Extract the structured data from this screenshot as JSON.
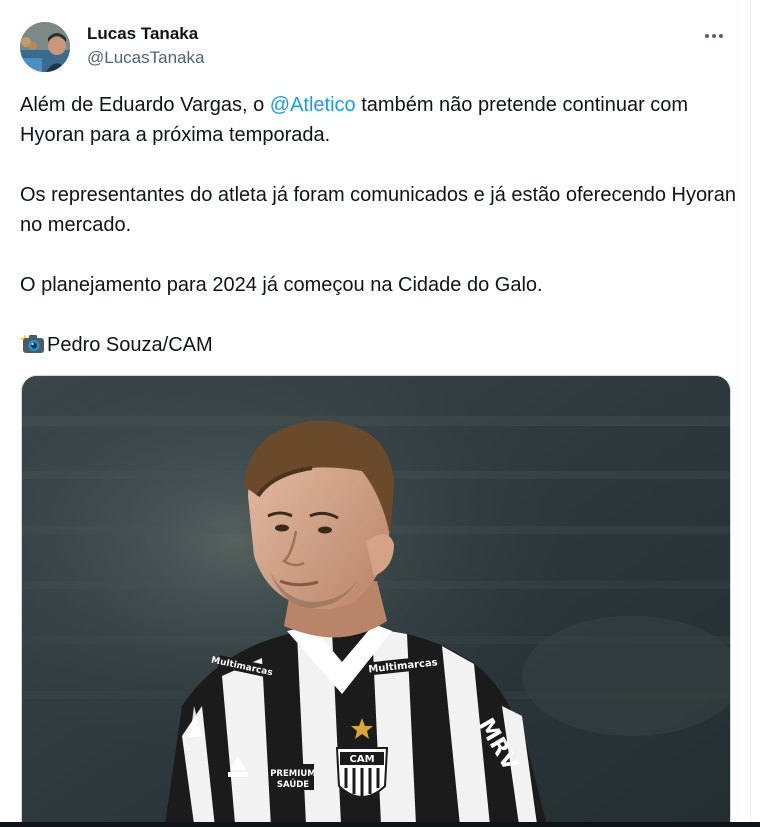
{
  "tweet": {
    "author": {
      "display_name": "Lucas Tanaka",
      "handle": "@LucasTanaka",
      "avatar_icon": "avatar-photo"
    },
    "menu_icon": "more-icon",
    "body": {
      "para1_before": "Além de Eduardo Vargas, o ",
      "para1_mention": "@Atletico",
      "para1_after": " também não pretende continuar com Hyoran para a próxima temporada.",
      "para2": "Os representantes do atleta já foram comunicados e já estão oferecendo Hyoran no mercado.",
      "para3": "O planejamento para 2024 já começou na Cidade do Galo.",
      "credit_icon": "camera-flash-icon",
      "credit": "Pedro Souza/CAM"
    },
    "media": {
      "kind": "photo",
      "jersey_texts": {
        "sponsor_left": "Multimarcas",
        "sponsor_right": "Multimarcas",
        "premium_line1": "PREMIUM",
        "premium_line2": "SAÚDE",
        "badge": "CAM",
        "sleeve": "MRV"
      }
    },
    "colors": {
      "text": "#0f1419",
      "secondary": "#536471",
      "link": "#1d9bf0",
      "border": "#cfd9de"
    }
  }
}
